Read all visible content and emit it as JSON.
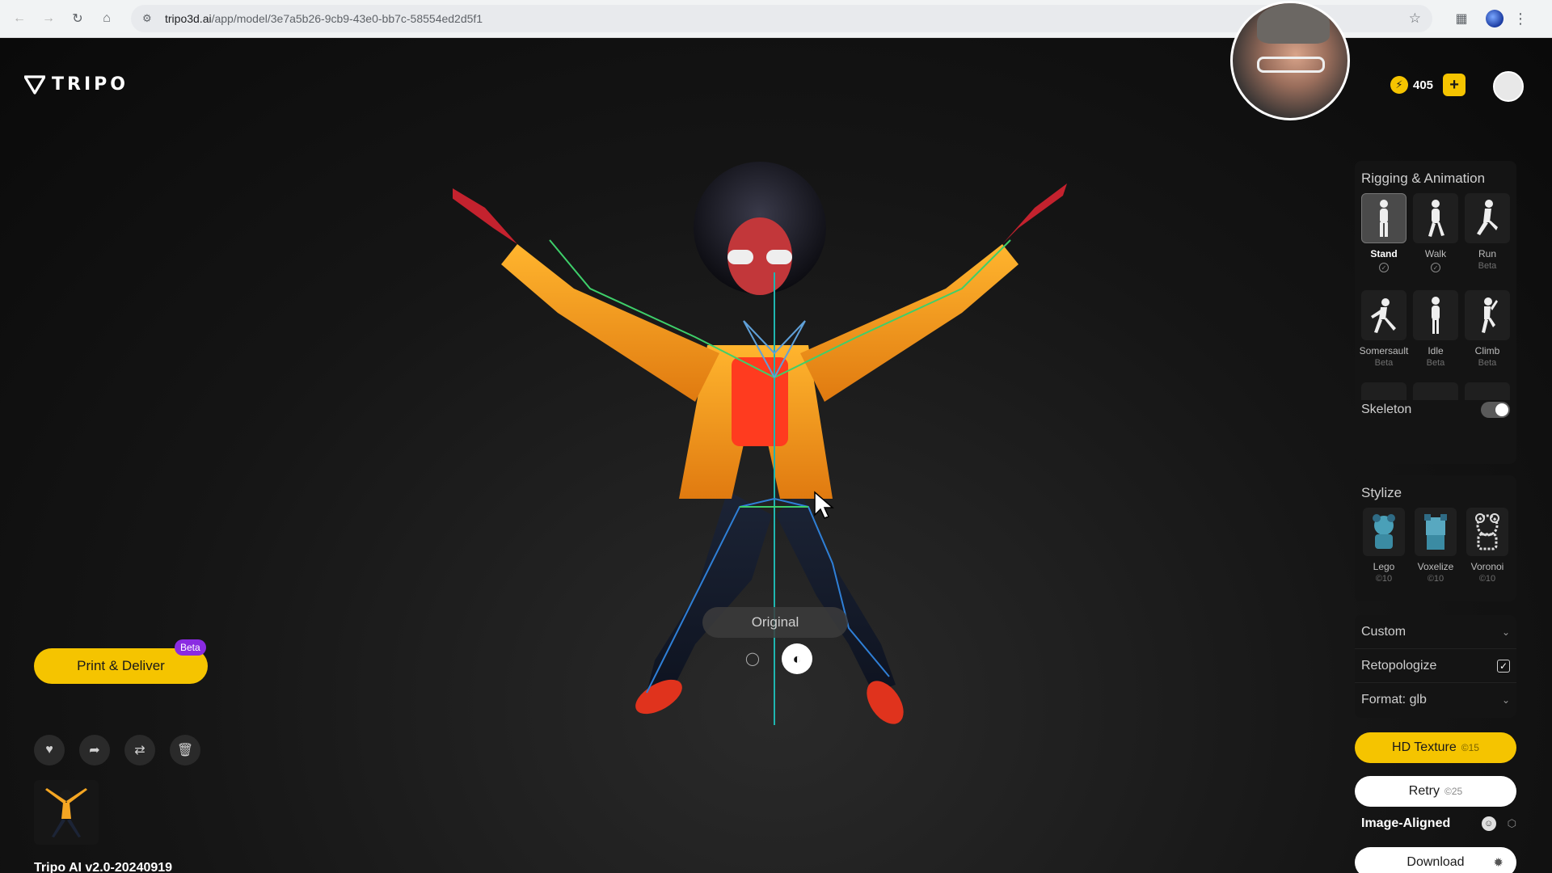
{
  "browser": {
    "url_host": "tripo3d.ai",
    "url_path": "/app/model/3e7a5b26-9cb9-43e0-bb7c-58554ed2d5f1"
  },
  "header": {
    "logo_text": "TRIPO",
    "credits": "405",
    "plus": "+"
  },
  "viewer": {
    "mode_label": "Original"
  },
  "left": {
    "print_label": "Print & Deliver",
    "beta_tag": "Beta",
    "version": "Tripo AI v2.0-20240919"
  },
  "rigging": {
    "title": "Rigging & Animation",
    "items": [
      {
        "name": "Stand",
        "sub": "",
        "check": true,
        "active": true
      },
      {
        "name": "Walk",
        "sub": "",
        "check": true,
        "active": false
      },
      {
        "name": "Run",
        "sub": "Beta",
        "check": false,
        "active": false
      },
      {
        "name": "Somersault",
        "sub": "Beta",
        "check": false,
        "active": false
      },
      {
        "name": "Idle",
        "sub": "Beta",
        "check": false,
        "active": false
      },
      {
        "name": "Climb",
        "sub": "Beta",
        "check": false,
        "active": false
      }
    ],
    "skeleton_label": "Skeleton",
    "skeleton_on": true
  },
  "stylize": {
    "title": "Stylize",
    "items": [
      {
        "name": "Lego",
        "cost": "10"
      },
      {
        "name": "Voxelize",
        "cost": "10"
      },
      {
        "name": "Voronoi",
        "cost": "10"
      }
    ]
  },
  "options": {
    "custom": "Custom",
    "retopologize": "Retopologize",
    "format": "Format: glb"
  },
  "actions": {
    "hd_label": "HD Texture",
    "hd_cost": "15",
    "retry_label": "Retry",
    "retry_cost": "25",
    "aligned_label": "Image-Aligned",
    "download_label": "Download"
  },
  "colors": {
    "accent": "#f5c400",
    "beta": "#8a2be2",
    "jacket": "#f5a623",
    "shirt": "#ff3b1f"
  }
}
